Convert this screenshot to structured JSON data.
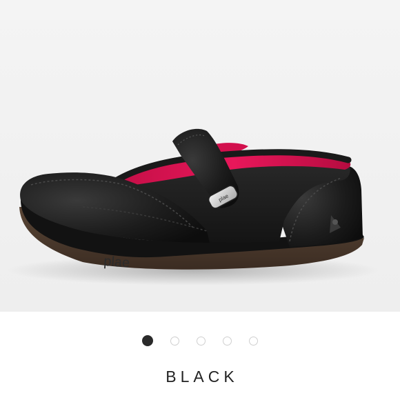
{
  "product": {
    "image": "black-mary-jane-shoe-photo",
    "brand_mark": "plae",
    "color_name": "BLACK"
  },
  "carousel": {
    "total": 5,
    "active_index": 0
  }
}
